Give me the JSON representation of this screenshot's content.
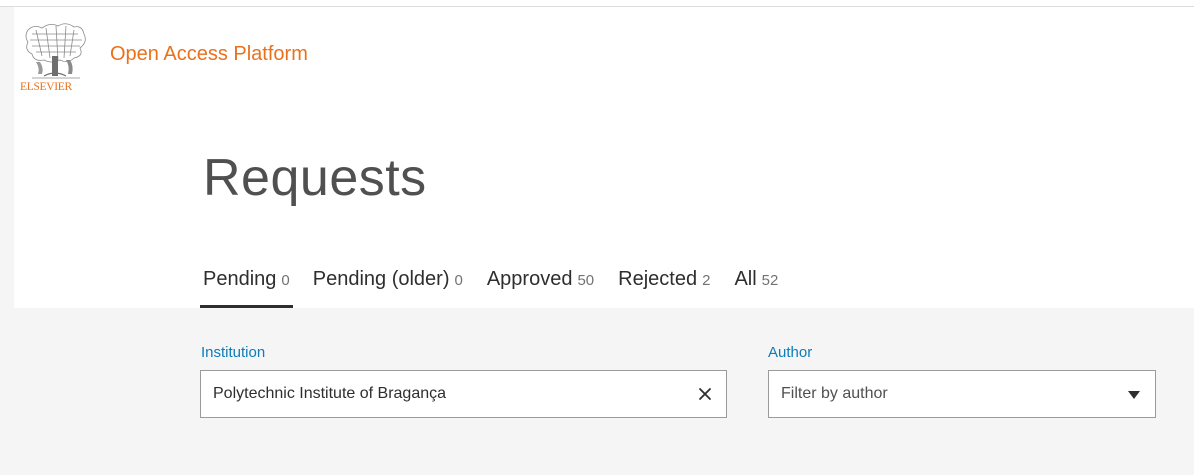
{
  "brand": {
    "logo_text": "ELSEVIER",
    "app_title": "Open Access Platform",
    "accent_color": "#e9711c"
  },
  "main": {
    "title": "Requests"
  },
  "tabs": [
    {
      "label": "Pending",
      "count": "0",
      "active": true
    },
    {
      "label": "Pending (older)",
      "count": "0",
      "active": false
    },
    {
      "label": "Approved",
      "count": "50",
      "active": false
    },
    {
      "label": "Rejected",
      "count": "2",
      "active": false
    },
    {
      "label": "All",
      "count": "52",
      "active": false
    }
  ],
  "filters": {
    "institution": {
      "label": "Institution",
      "value": "Polytechnic Institute of Bragança",
      "clear_icon": "close-icon"
    },
    "author": {
      "label": "Author",
      "placeholder": "Filter by author",
      "dropdown_icon": "caret-down-icon"
    },
    "label_color": "#0c7dbb"
  }
}
